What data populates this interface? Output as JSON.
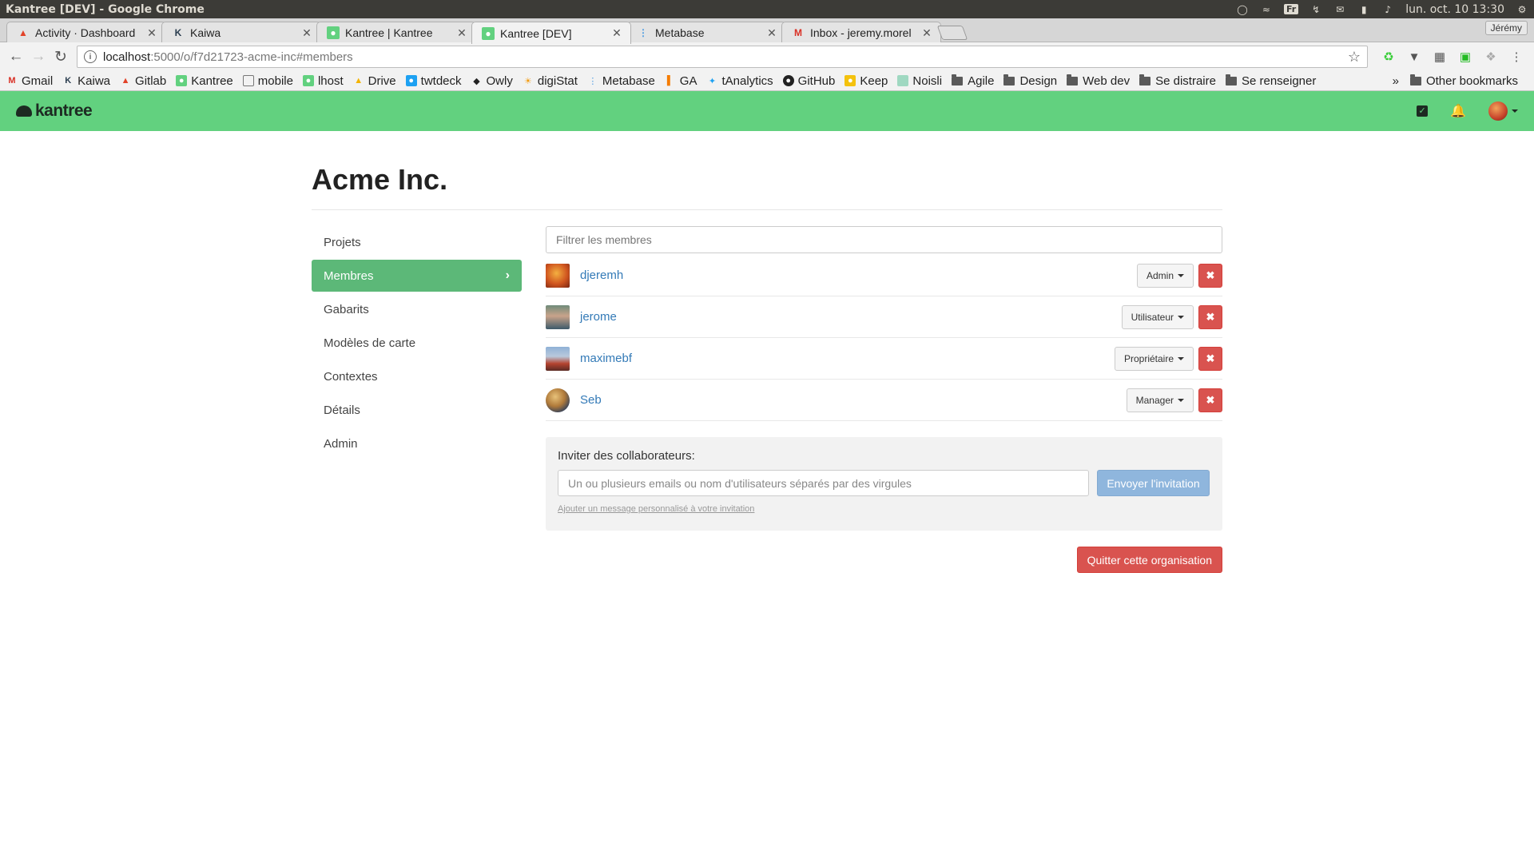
{
  "window": {
    "title": "Kantree [DEV] - Google Chrome"
  },
  "system_tray": {
    "keyboard_layout": "Fr",
    "datetime": "lun. oct. 10 13:30"
  },
  "tabs": [
    {
      "label": "Activity · Dashboard",
      "favicon": "gitlab-icon"
    },
    {
      "label": "Kaiwa",
      "favicon": "kaiwa-icon"
    },
    {
      "label": "Kantree | Kantree",
      "favicon": "kantree-icon"
    },
    {
      "label": "Kantree [DEV]",
      "favicon": "kantree-icon",
      "active": true
    },
    {
      "label": "Metabase",
      "favicon": "metabase-icon"
    },
    {
      "label": "Inbox - jeremy.morel",
      "favicon": "gmail-icon"
    }
  ],
  "profile_name": "Jérémy",
  "address_bar": {
    "host": "localhost",
    "path": ":5000/o/f7d21723-acme-inc#members"
  },
  "bookmarks": [
    {
      "label": "Gmail",
      "icon": "gmail-icon"
    },
    {
      "label": "Kaiwa",
      "icon": "kaiwa-icon"
    },
    {
      "label": "Gitlab",
      "icon": "gitlab-icon"
    },
    {
      "label": "Kantree",
      "icon": "kantree-icon"
    },
    {
      "label": "mobile",
      "icon": "page-icon"
    },
    {
      "label": "lhost",
      "icon": "kantree-icon"
    },
    {
      "label": "Drive",
      "icon": "drive-icon"
    },
    {
      "label": "twtdeck",
      "icon": "tweetdeck-icon"
    },
    {
      "label": "Owly",
      "icon": "owly-icon"
    },
    {
      "label": "digiStat",
      "icon": "digistat-icon"
    },
    {
      "label": "Metabase",
      "icon": "metabase-icon"
    },
    {
      "label": "GA",
      "icon": "analytics-icon"
    },
    {
      "label": "tAnalytics",
      "icon": "twitter-icon"
    },
    {
      "label": "GitHub",
      "icon": "github-icon"
    },
    {
      "label": "Keep",
      "icon": "keep-icon"
    },
    {
      "label": "Noisli",
      "icon": "noisli-icon"
    },
    {
      "label": "Agile",
      "icon": "folder-icon"
    },
    {
      "label": "Design",
      "icon": "folder-icon"
    },
    {
      "label": "Web dev",
      "icon": "folder-icon"
    },
    {
      "label": "Se distraire",
      "icon": "folder-icon"
    },
    {
      "label": "Se renseigner",
      "icon": "folder-icon"
    }
  ],
  "bookmarks_overflow": "»",
  "other_bookmarks": "Other bookmarks",
  "app": {
    "logo_text": "kantree",
    "brand_color": "#62d17f"
  },
  "org": {
    "name": "Acme Inc."
  },
  "side_nav": [
    {
      "label": "Projets"
    },
    {
      "label": "Membres",
      "active": true
    },
    {
      "label": "Gabarits"
    },
    {
      "label": "Modèles de carte"
    },
    {
      "label": "Contextes"
    },
    {
      "label": "Détails"
    },
    {
      "label": "Admin"
    }
  ],
  "members_filter": {
    "placeholder": "Filtrer les membres"
  },
  "members": [
    {
      "username": "djeremh",
      "role": "Admin"
    },
    {
      "username": "jerome",
      "role": "Utilisateur"
    },
    {
      "username": "maximebf",
      "role": "Propriétaire"
    },
    {
      "username": "Seb",
      "role": "Manager"
    }
  ],
  "invite": {
    "label": "Inviter des collaborateurs:",
    "placeholder": "Un ou plusieurs emails ou nom d'utilisateurs séparés par des virgules",
    "send_label": "Envoyer l'invitation",
    "custom_message_link": "Ajouter un message personnalisé à votre invitation"
  },
  "leave_label": "Quitter cette organisation",
  "colors": {
    "danger": "#d9534f",
    "link": "#337ab7",
    "active_nav": "#5cb878"
  }
}
